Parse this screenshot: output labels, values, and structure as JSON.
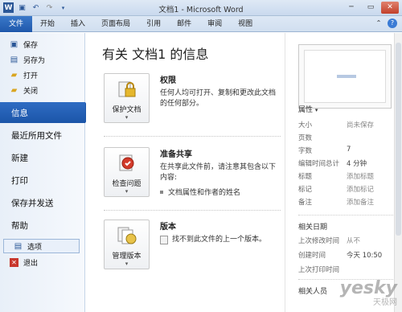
{
  "window": {
    "title": "文档1 - Microsoft Word"
  },
  "ribbon": {
    "tabs": [
      "文件",
      "开始",
      "插入",
      "页面布局",
      "引用",
      "邮件",
      "审阅",
      "视图"
    ]
  },
  "nav": {
    "top_items": [
      "保存",
      "另存为",
      "打开",
      "关闭"
    ],
    "main_items": [
      "信息",
      "最近所用文件",
      "新建",
      "打印",
      "保存并发送",
      "帮助"
    ],
    "bottom_items": [
      "选项",
      "退出"
    ]
  },
  "main": {
    "title": "有关 文档1 的信息",
    "sections": [
      {
        "button": "保护文档",
        "title": "权限",
        "desc": "任何人均可打开、复制和更改此文档的任何部分。"
      },
      {
        "button": "检查问题",
        "title": "准备共享",
        "desc": "在共享此文件前，请注意其包含以下内容:",
        "bullet": "文档属性和作者的姓名"
      },
      {
        "button": "管理版本",
        "title": "版本",
        "desc": "找不到此文件的上一个版本。"
      }
    ]
  },
  "properties": {
    "header": "属性",
    "rows": [
      {
        "k": "大小",
        "v": "尚未保存"
      },
      {
        "k": "页数",
        "v": ""
      },
      {
        "k": "字数",
        "v": "7"
      },
      {
        "k": "编辑时间总计",
        "v": "4 分钟"
      },
      {
        "k": "标题",
        "v": "添加标题"
      },
      {
        "k": "标记",
        "v": "添加标记"
      },
      {
        "k": "备注",
        "v": "添加备注"
      }
    ],
    "dates_header": "相关日期",
    "dates": [
      {
        "k": "上次修改时间",
        "v": "从不"
      },
      {
        "k": "创建时间",
        "v": "今天 10:50"
      },
      {
        "k": "上次打印时间",
        "v": ""
      }
    ],
    "people_header": "相关人员"
  },
  "watermark": {
    "main": "yesky",
    "sub": "天极网"
  },
  "colors": {
    "file_tab": "#2a64b8",
    "active_nav": "#1f5bad"
  }
}
